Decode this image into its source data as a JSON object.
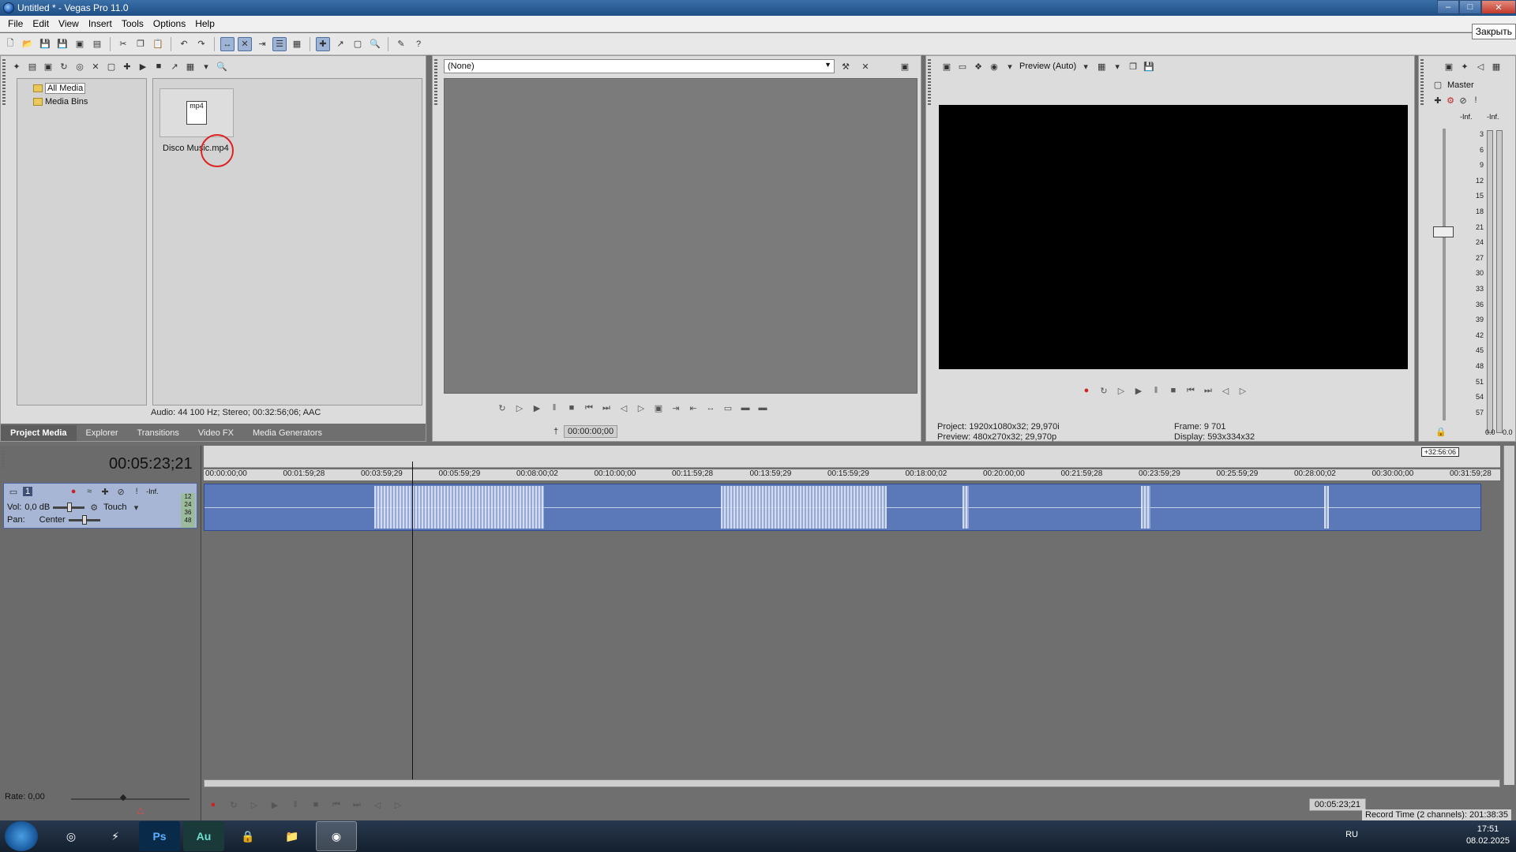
{
  "window": {
    "title": "Untitled * - Vegas Pro 11.0",
    "close_tooltip": "Закрыть"
  },
  "menu": [
    "File",
    "Edit",
    "View",
    "Insert",
    "Tools",
    "Options",
    "Help"
  ],
  "media": {
    "tree": [
      "All Media",
      "Media Bins"
    ],
    "file_name": "Disco Music.mp4",
    "file_badge": "mp4",
    "status": "Audio: 44 100 Hz; Stereo; 00:32:56;06; AAC",
    "tabs": [
      "Project Media",
      "Explorer",
      "Transitions",
      "Video FX",
      "Media Generators"
    ]
  },
  "trimmer": {
    "select_value": "(None)",
    "time": "00:00:00;00"
  },
  "preview": {
    "mode": "Preview (Auto)",
    "project_label": "Project:",
    "project_value": "1920x1080x32; 29,970i",
    "preview_label": "Preview:",
    "preview_value": "480x270x32; 29,970p",
    "frame_label": "Frame:",
    "frame_value": "9 701",
    "display_label": "Display:",
    "display_value": "593x334x32"
  },
  "master": {
    "title": "Master",
    "inf_left": "-Inf.",
    "inf_right": "-Inf.",
    "scale": [
      "3",
      "6",
      "9",
      "12",
      "15",
      "18",
      "21",
      "24",
      "27",
      "30",
      "33",
      "36",
      "39",
      "42",
      "45",
      "48",
      "51",
      "54",
      "57"
    ],
    "bottom_left": "0.0",
    "bottom_right": "0.0"
  },
  "timeline": {
    "current_time": "00:05:23;21",
    "end_marker": "+32:56:06",
    "ruler": [
      "00:00:00;00",
      "00:01:59;28",
      "00:03:59;29",
      "00:05:59;29",
      "00:08:00;02",
      "00:10:00;00",
      "00:11:59;28",
      "00:13:59;29",
      "00:15:59;29",
      "00:18:00;02",
      "00:20:00;00",
      "00:21:59;28",
      "00:23:59;29",
      "00:25:59;29",
      "00:28:00;02",
      "00:30:00;00",
      "00:31:59;28"
    ],
    "track": {
      "number": "1",
      "vol_label": "Vol:",
      "vol_value": "0,0 dB",
      "pan_label": "Pan:",
      "pan_value": "Center",
      "automation": "Touch",
      "inf": "-Inf.",
      "meter_labels": [
        "12",
        "24",
        "36",
        "48"
      ]
    },
    "rate": "Rate: 0,00",
    "bottom_time": "00:05:23;21",
    "record_time": "Record Time (2 channels): 201:38:35"
  },
  "taskbar": {
    "apps": [
      "Chrome",
      "Flash",
      "Ps",
      "Au",
      "Lock",
      "Explorer",
      "Vegas"
    ],
    "lang": "RU",
    "time": "17:51",
    "date": "08.02.2025"
  }
}
